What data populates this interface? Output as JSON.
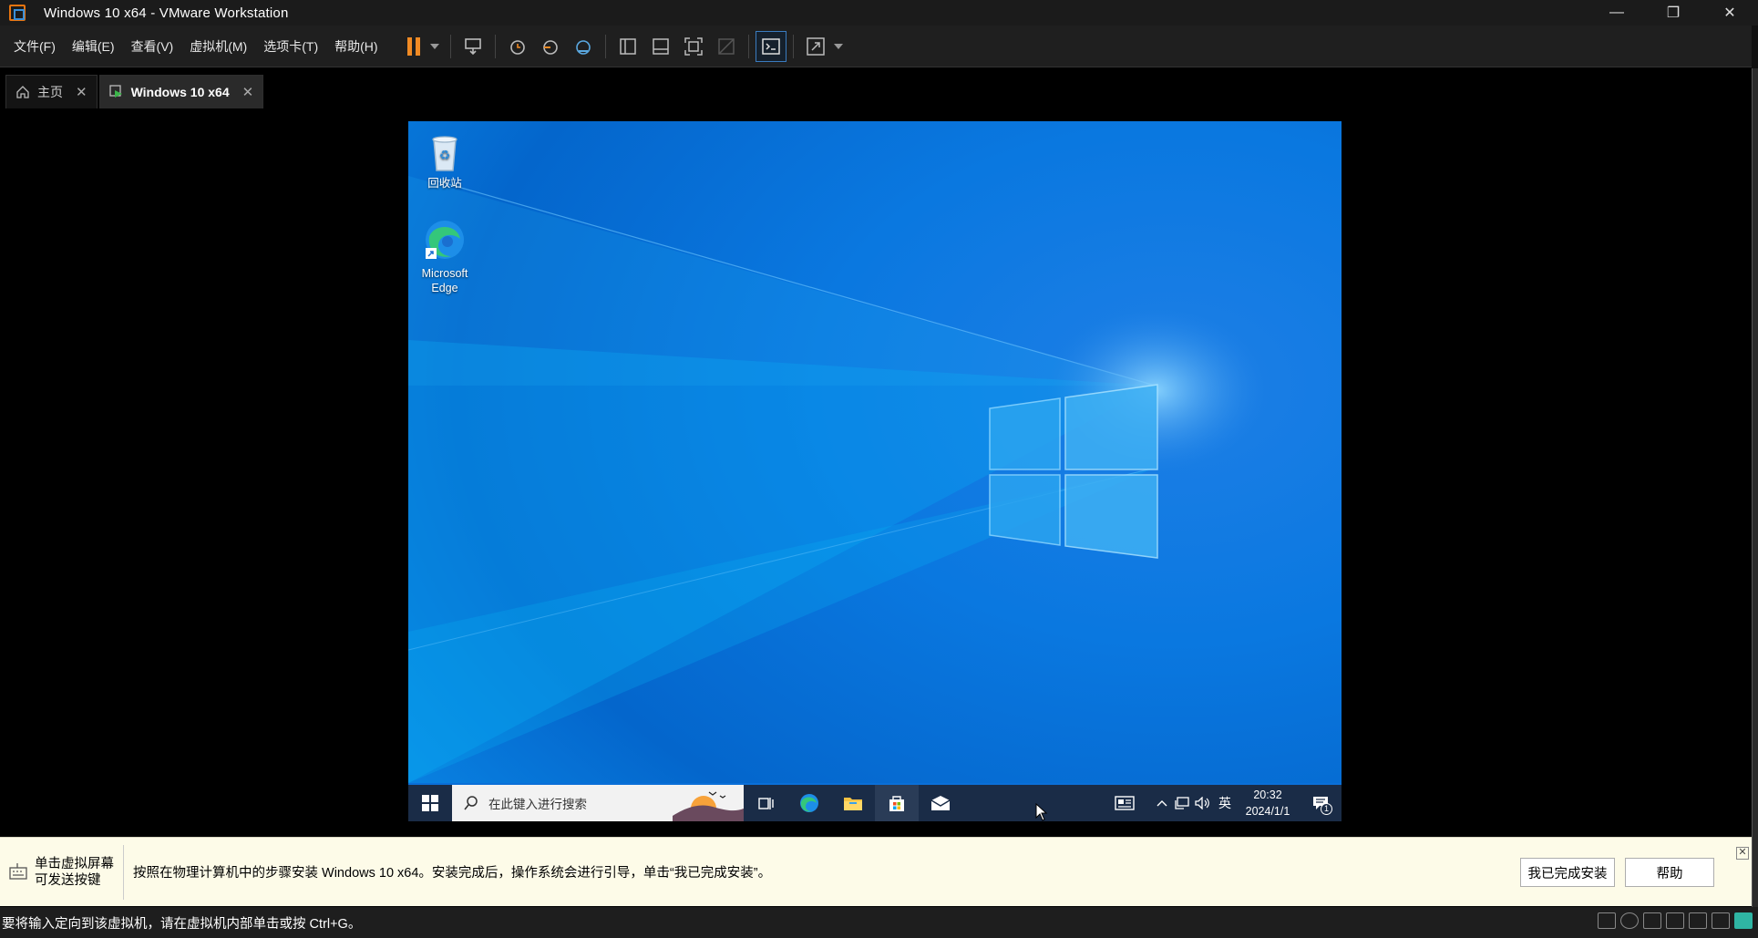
{
  "window": {
    "title": "Windows 10 x64 - VMware Workstation",
    "min": "—",
    "restore": "❐",
    "close": "✕"
  },
  "menu": [
    "文件(F)",
    "编辑(E)",
    "查看(V)",
    "虚拟机(M)",
    "选项卡(T)",
    "帮助(H)"
  ],
  "tabs": [
    {
      "label": "主页",
      "close": "✕"
    },
    {
      "label": "Windows 10 x64",
      "close": "✕"
    }
  ],
  "desktop": {
    "icons": [
      {
        "label": "回收站"
      },
      {
        "label_line1": "Microsoft",
        "label_line2": "Edge"
      }
    ]
  },
  "taskbar": {
    "search_placeholder": "在此键入进行搜索",
    "ime": "英",
    "time": "20:32",
    "date": "2024/1/1",
    "notification_count": "1"
  },
  "hint": {
    "left_line1": "单击虚拟屏幕",
    "left_line2": "可发送按键",
    "message": "按照在物理计算机中的步骤安装 Windows 10 x64。安装完成后，操作系统会进行引导，单击“我已完成安装”。",
    "done_button": "我已完成安装",
    "help_button": "帮助",
    "close": "✕"
  },
  "statusbar": {
    "text": "要将输入定向到该虚拟机，请在虚拟机内部单击或按 Ctrl+G。"
  },
  "colors": {
    "accent": "#f08a24",
    "vm_bg": "#0a6fd8",
    "hint_bg": "#fdfbe8",
    "taskbar": "#1a2c47"
  }
}
